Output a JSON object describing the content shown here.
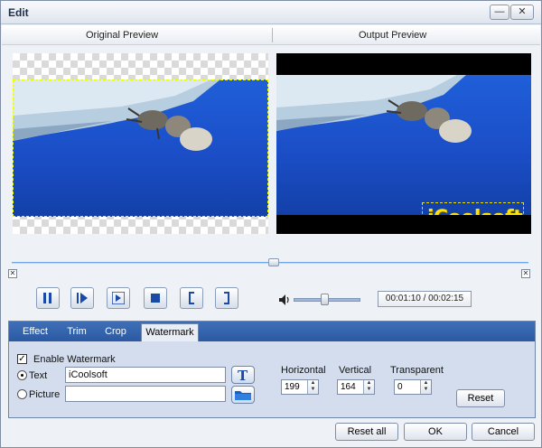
{
  "window": {
    "title": "Edit",
    "minimize_glyph": "—",
    "close_glyph": "✕"
  },
  "preview": {
    "original_label": "Original Preview",
    "output_label": "Output Preview"
  },
  "watermark_overlay_text": "iCoolsoft",
  "timeline": {
    "start_marker": "✕",
    "end_marker": "✕",
    "position_fraction": 0.5
  },
  "controls": {
    "icons": [
      "pause-icon",
      "play-icon",
      "next-frame-icon",
      "stop-icon",
      "mark-in-icon",
      "mark-out-icon"
    ],
    "volume_level": 0.45,
    "time_display": "00:01:10 / 00:02:15"
  },
  "tabs": [
    {
      "label": "Effect",
      "active": false
    },
    {
      "label": "Trim",
      "active": false
    },
    {
      "label": "Crop",
      "active": false
    },
    {
      "label": "Watermark",
      "active": true
    }
  ],
  "watermark": {
    "enable_label": "Enable Watermark",
    "enabled": true,
    "text_option_label": "Text",
    "picture_option_label": "Picture",
    "text_value": "iCoolsoft",
    "picture_value": "",
    "horizontal_label": "Horizontal",
    "horizontal_value": "199",
    "vertical_label": "Vertical",
    "vertical_value": "164",
    "transparent_label": "Transparent",
    "transparent_value": "0",
    "reset_label": "Reset"
  },
  "footer": {
    "reset_all_label": "Reset all",
    "ok_label": "OK",
    "cancel_label": "Cancel"
  },
  "colors": {
    "tab_bar": "#2b5aa3",
    "watermark_text": "#ffe400",
    "video_sky": "#1f5fd9"
  }
}
